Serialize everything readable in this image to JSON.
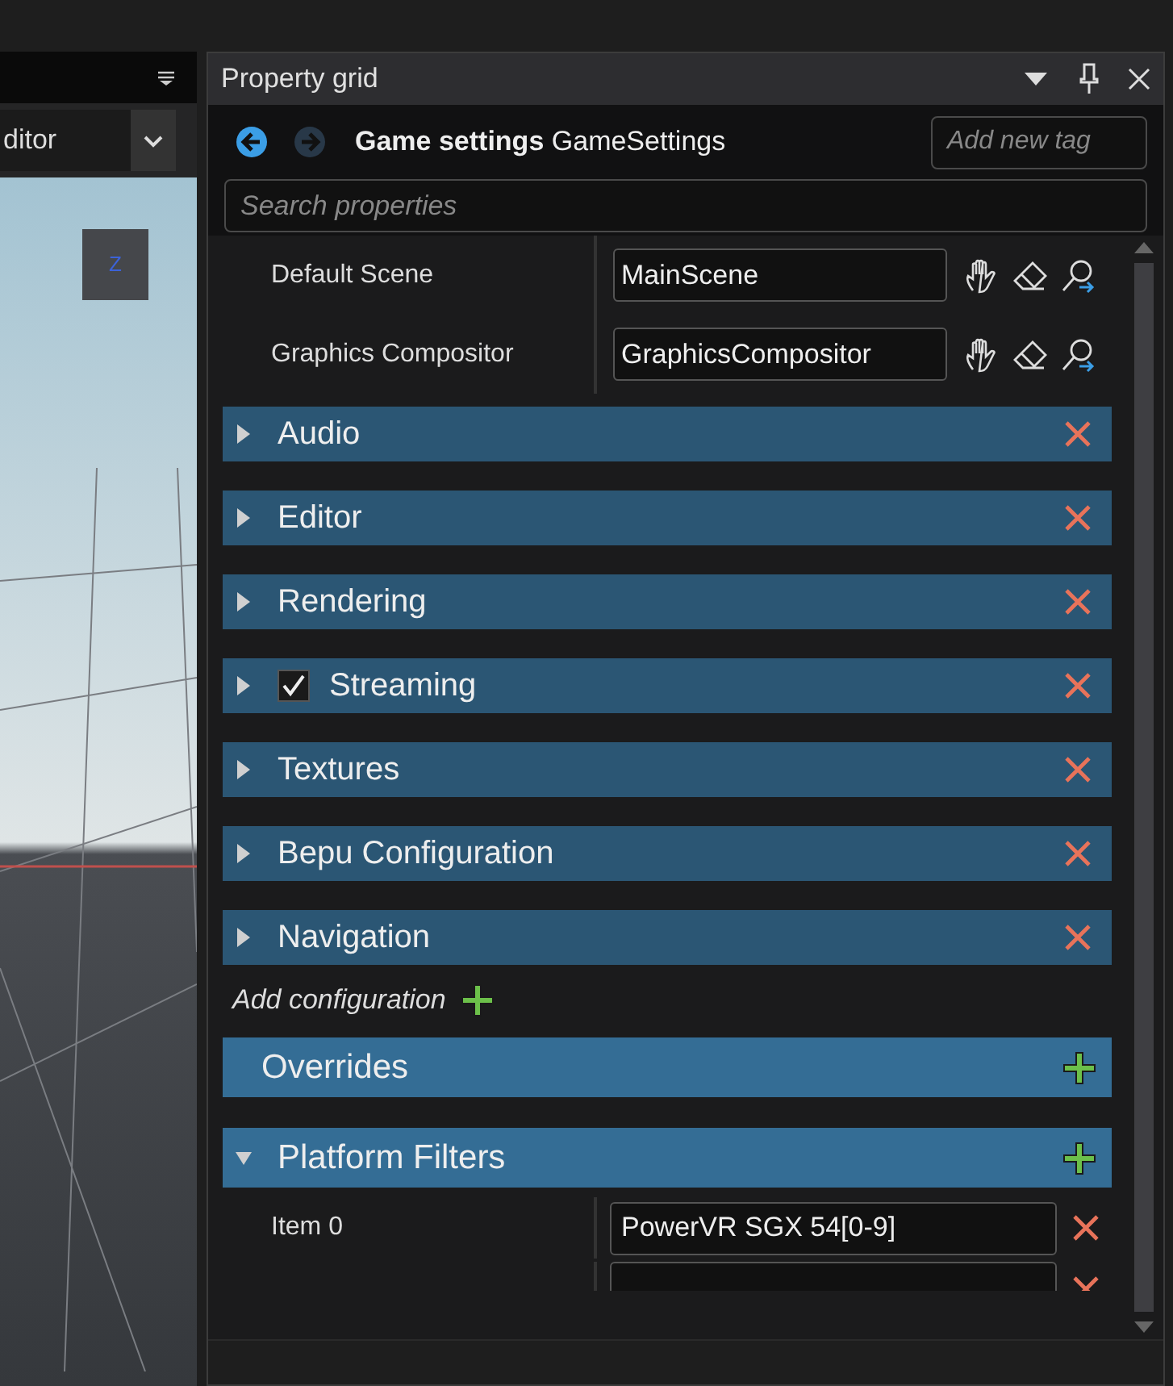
{
  "left_panel": {
    "editor_dropdown": "ditor",
    "gizmo_label": "Z"
  },
  "property_grid": {
    "title": "Property grid",
    "header": {
      "title_bold": "Game settings",
      "title_type": "GameSettings",
      "tag_placeholder": "Add new tag"
    },
    "search": {
      "placeholder": "Search properties"
    },
    "properties": [
      {
        "label": "Default Scene",
        "value": "MainScene"
      },
      {
        "label": "Graphics Compositor",
        "value": "GraphicsCompositor"
      }
    ],
    "configurations": [
      {
        "label": "Audio",
        "kind": "plain",
        "expanded": false
      },
      {
        "label": "Editor",
        "kind": "plain",
        "expanded": false
      },
      {
        "label": "Rendering",
        "kind": "plain",
        "expanded": false
      },
      {
        "label": "Streaming",
        "kind": "checkbox",
        "checked": true,
        "expanded": false
      },
      {
        "label": "Textures",
        "kind": "plain",
        "expanded": false
      },
      {
        "label": "Bepu Configuration",
        "kind": "plain",
        "expanded": false
      },
      {
        "label": "Navigation",
        "kind": "plain",
        "expanded": false
      }
    ],
    "add_configuration": "Add configuration",
    "overrides": {
      "label": "Overrides"
    },
    "platform_filters": {
      "label": "Platform Filters",
      "expanded": true,
      "items": [
        {
          "label": "Item 0",
          "value": "PowerVR SGX 54[0-9]"
        }
      ]
    }
  }
}
